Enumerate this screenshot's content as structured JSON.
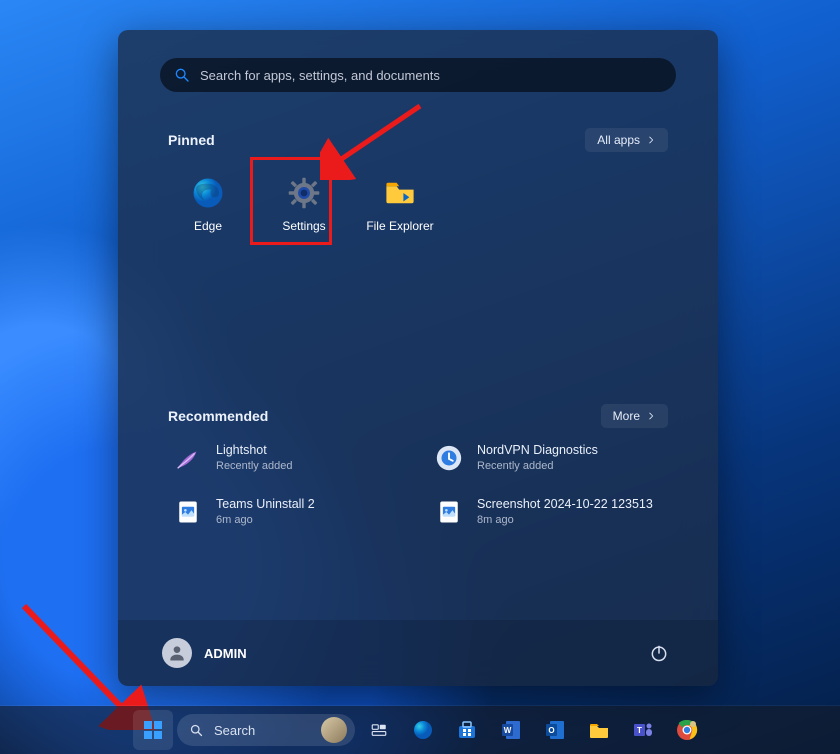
{
  "search": {
    "placeholder": "Search for apps, settings, and documents"
  },
  "pinned": {
    "title": "Pinned",
    "all_apps_label": "All apps",
    "apps": [
      {
        "label": "Edge"
      },
      {
        "label": "Settings"
      },
      {
        "label": "File Explorer"
      }
    ]
  },
  "recommended": {
    "title": "Recommended",
    "more_label": "More",
    "items": [
      {
        "title": "Lightshot",
        "sub": "Recently added"
      },
      {
        "title": "NordVPN Diagnostics",
        "sub": "Recently added"
      },
      {
        "title": "Teams Uninstall 2",
        "sub": "6m ago"
      },
      {
        "title": "Screenshot 2024-10-22 123513",
        "sub": "8m ago"
      }
    ]
  },
  "user": {
    "name": "ADMIN"
  },
  "taskbar_search": {
    "label": "Search"
  },
  "colors": {
    "accent": "#1e88ff",
    "highlight": "#eb1b1b"
  }
}
